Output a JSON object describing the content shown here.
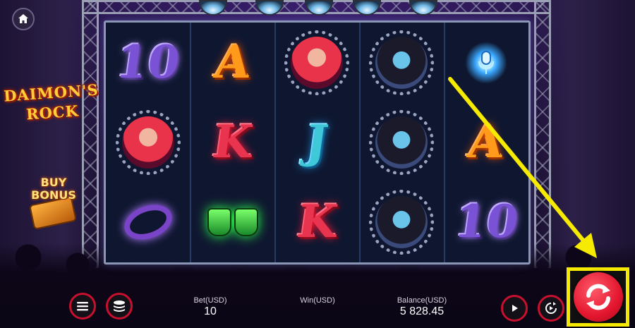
{
  "game": {
    "logo_text": "DAIMON'S ROCK",
    "buy_bonus_label": "BUY BONUS"
  },
  "reels": [
    [
      "ten-symbol",
      "a-symbol",
      "female-singer-symbol",
      "male-singer-symbol",
      "microphone-symbol"
    ],
    [
      "female-singer-symbol",
      "k-symbol",
      "j-symbol",
      "male-singer-symbol",
      "a-symbol"
    ],
    [
      "spiked-ring-symbol",
      "drums-symbol",
      "k-symbol",
      "male-singer-symbol",
      "ten-symbol"
    ],
    [
      "",
      "",
      "",
      "",
      ""
    ]
  ],
  "symbol_text": {
    "ten": "10",
    "a": "A",
    "k": "K",
    "j": "J"
  },
  "bottom_bar": {
    "bet_label": "Bet(USD)",
    "bet_value": "10",
    "win_label": "Win(USD)",
    "win_value": "",
    "balance_label": "Balance(USD)",
    "balance_value": "5 828.45"
  },
  "icons": {
    "home": "home-icon",
    "menu": "hamburger-menu-icon",
    "bet": "coin-stack-icon",
    "play": "play-icon",
    "autoplay": "autoplay-icon",
    "spin": "spin-arrows-icon"
  },
  "colors": {
    "button_ring": "#c8102e",
    "spin_red": "#e3162e",
    "annotation_yellow": "#f6ea00"
  }
}
